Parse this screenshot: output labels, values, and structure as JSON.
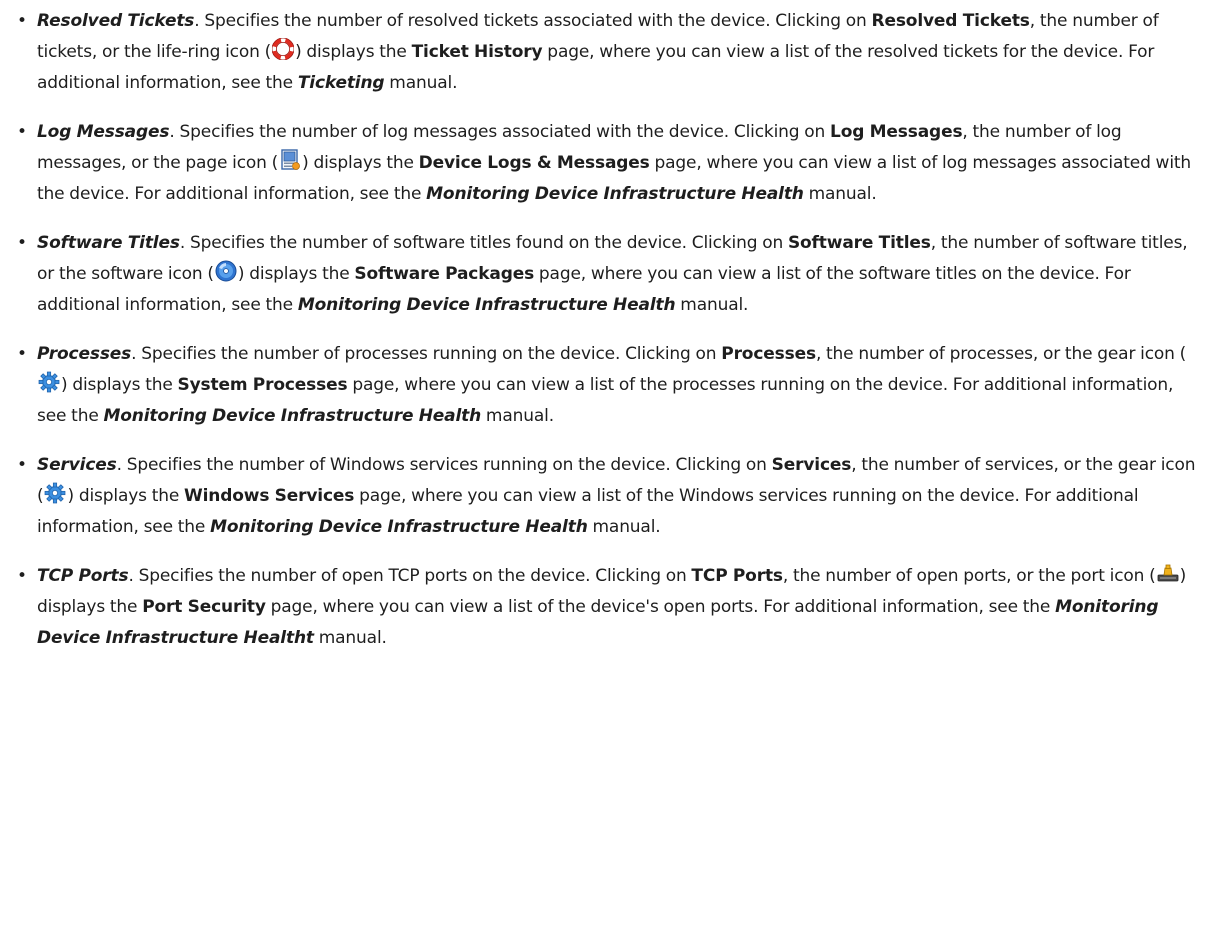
{
  "items": [
    {
      "term": "Resolved Tickets",
      "desc_before_link": ". Specifies the number of resolved tickets associated with the device. Clicking on ",
      "link_label": "Resolved Tickets",
      "desc_before_icon": ", the number of tickets, or the life-ring icon (",
      "icon": "life-ring-icon",
      "desc_after_icon": ") displays the ",
      "page_name": "Ticket History",
      "desc_after_page": " page, where you can view a list of the resolved tickets for the device. For additional information, see the ",
      "manual_name": "Ticketing",
      "manual_suffix": " manual."
    },
    {
      "term": "Log Messages",
      "desc_before_link": ". Specifies the number of log messages associated with the device. Clicking on ",
      "link_label": "Log Messages",
      "desc_before_icon": ", the number of log messages, or the page icon (",
      "icon": "page-icon",
      "desc_after_icon": ") displays the ",
      "page_name": "Device Logs & Messages",
      "desc_after_page": " page, where you can view a list of log messages associated with the device. For additional information, see the ",
      "manual_name": "Monitoring Device Infrastructure Health",
      "manual_suffix": " manual."
    },
    {
      "term": "Software Titles",
      "desc_before_link": ". Specifies the number of software titles found on the device. Clicking on ",
      "link_label": "Software Titles",
      "desc_before_icon": ", the number of software titles, or the software icon (",
      "icon": "software-disc-icon",
      "desc_after_icon": ") displays the ",
      "page_name": "Software Packages",
      "desc_after_page": " page, where you can view a list of the software titles on the device. For additional information, see the ",
      "manual_name": "Monitoring Device Infrastructure Health",
      "manual_suffix": " manual."
    },
    {
      "term": "Processes",
      "desc_before_link": ". Specifies the number of processes running on the device. Clicking on ",
      "link_label": "Processes",
      "desc_before_icon": ", the number of processes, or the gear icon (",
      "icon": "gear-icon",
      "desc_after_icon": ") displays the ",
      "page_name": "System Processes",
      "desc_after_page": " page, where you can view a list of the processes running on the device. For additional information, see the ",
      "manual_name": "Monitoring Device Infrastructure Health",
      "manual_suffix": " manual."
    },
    {
      "term": "Services",
      "desc_before_link": ". Specifies the number of Windows services running on the device. Clicking on ",
      "link_label": "Services",
      "desc_before_icon": ", the number of services, or the gear icon (",
      "icon": "gear-icon",
      "desc_after_icon": ") displays the ",
      "page_name": "Windows Services",
      "desc_after_page": " page, where you can view a list of the Windows services running on the device. For additional information, see the ",
      "manual_name": "Monitoring Device Infrastructure Health",
      "manual_suffix": " manual."
    },
    {
      "term": "TCP Ports",
      "desc_before_link": ". Specifies the number of open TCP ports on the device. Clicking on ",
      "link_label": "TCP Ports",
      "desc_before_icon": ", the number of open ports, or the port icon (",
      "icon": "port-icon",
      "desc_after_icon": ") displays the ",
      "page_name": "Port Security",
      "desc_after_page": " page, where you can view a list of the device's open ports. For additional information, see the ",
      "manual_name": "Monitoring Device Infrastructure Healtht",
      "manual_suffix": " manual."
    }
  ]
}
